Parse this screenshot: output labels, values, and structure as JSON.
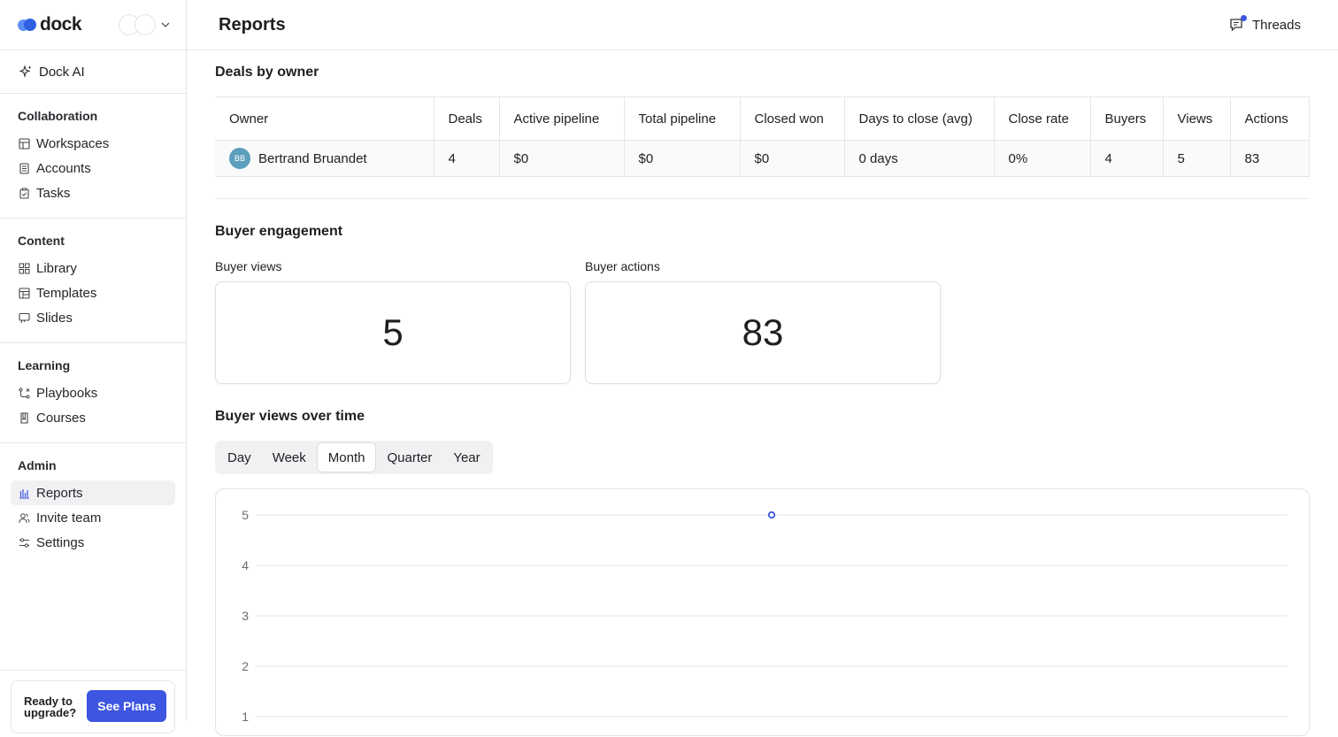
{
  "brand": {
    "name": "dock"
  },
  "sidebar": {
    "ai": {
      "label": "Dock AI"
    },
    "sections": [
      {
        "title": "Collaboration",
        "items": [
          "Workspaces",
          "Accounts",
          "Tasks"
        ]
      },
      {
        "title": "Content",
        "items": [
          "Library",
          "Templates",
          "Slides"
        ]
      },
      {
        "title": "Learning",
        "items": [
          "Playbooks",
          "Courses"
        ]
      },
      {
        "title": "Admin",
        "items": [
          "Reports",
          "Invite team",
          "Settings"
        ]
      }
    ],
    "upgrade": {
      "text": "Ready to upgrade?",
      "button": "See Plans"
    }
  },
  "header": {
    "title": "Reports",
    "threads": "Threads"
  },
  "deals": {
    "title": "Deals by owner",
    "columns": [
      "Owner",
      "Deals",
      "Active pipeline",
      "Total pipeline",
      "Closed won",
      "Days to close (avg)",
      "Close rate",
      "Buyers",
      "Views",
      "Actions"
    ],
    "rows": [
      {
        "initials": "BB",
        "owner": "Bertrand Bruandet",
        "cells": [
          "4",
          "$0",
          "$0",
          "$0",
          "0 days",
          "0%",
          "4",
          "5",
          "83"
        ]
      }
    ]
  },
  "engagement": {
    "title": "Buyer engagement",
    "views_label": "Buyer views",
    "views_value": "5",
    "actions_label": "Buyer actions",
    "actions_value": "83"
  },
  "views_over_time": {
    "title": "Buyer views over time",
    "periods": [
      "Day",
      "Week",
      "Month",
      "Quarter",
      "Year"
    ],
    "selected": "Month"
  },
  "chart_data": {
    "type": "line",
    "y_ticks": [
      "5",
      "4",
      "3",
      "2",
      "1"
    ],
    "series": [
      {
        "values": [
          5
        ]
      }
    ],
    "point_color": "#3d55e0"
  }
}
